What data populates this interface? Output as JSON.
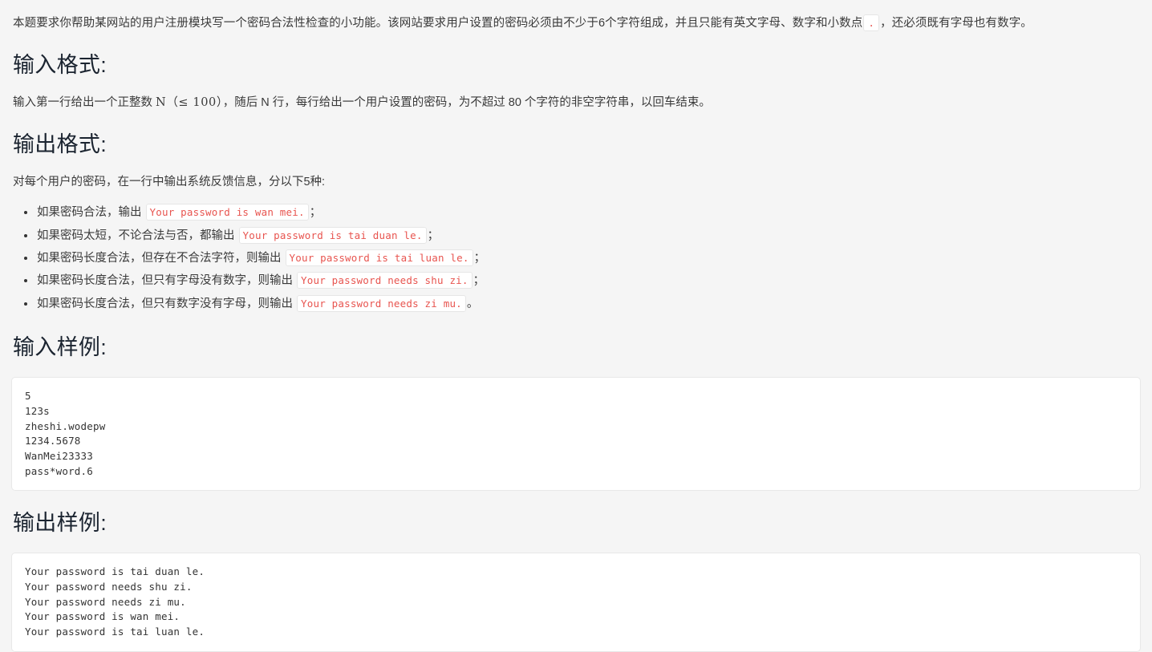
{
  "intro": {
    "before_code": "本题要求你帮助某网站的用户注册模块写一个密码合法性检查的小功能。该网站要求用户设置的密码必须由不少于6个字符组成，并且只能有英文字母、数字和小数点",
    "code": ".",
    "after_code": "，还必须既有字母也有数字。"
  },
  "input_format": {
    "title": "输入格式:",
    "text_before_math": "输入第一行给出一个正整数",
    "math": "N（≤ 100）",
    "text_after_math": "，随后 N 行，每行给出一个用户设置的密码，为不超过 80 个字符的非空字符串，以回车结束。"
  },
  "output_format": {
    "title": "输出格式:",
    "lead": "对每个用户的密码，在一行中输出系统反馈信息，分以下5种:",
    "rules": [
      {
        "prefix": "如果密码合法，输出",
        "code": "Your password is wan mei.",
        "suffix": "；"
      },
      {
        "prefix": "如果密码太短，不论合法与否，都输出",
        "code": "Your password is tai duan le.",
        "suffix": "；"
      },
      {
        "prefix": "如果密码长度合法，但存在不合法字符，则输出",
        "code": "Your password is tai luan le.",
        "suffix": "；"
      },
      {
        "prefix": "如果密码长度合法，但只有字母没有数字，则输出",
        "code": "Your password needs shu zi.",
        "suffix": "；"
      },
      {
        "prefix": "如果密码长度合法，但只有数字没有字母，则输出",
        "code": "Your password needs zi mu.",
        "suffix": "。"
      }
    ]
  },
  "input_sample": {
    "title": "输入样例:",
    "content": "5\n123s\nzheshi.wodepw\n1234.5678\nWanMei23333\npass*word.6"
  },
  "output_sample": {
    "title": "输出样例:",
    "content": "Your password is tai duan le.\nYour password needs shu zi.\nYour password needs zi mu.\nYour password is wan mei.\nYour password is tai luan le."
  },
  "colors": {
    "page_background": "#f5f5f5",
    "code_text": "#e8544f",
    "heading": "#1b2430",
    "body_text": "#3a3a3a",
    "block_background": "#ffffff",
    "block_border": "#e8e8e8"
  }
}
